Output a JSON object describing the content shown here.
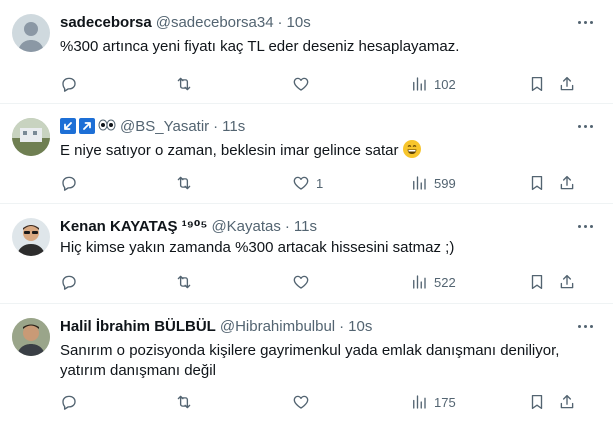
{
  "tweets": [
    {
      "name": "sadeceborsa",
      "handle": "@sadeceborsa34",
      "dot": "·",
      "time": "10s",
      "text": "%300 artınca yeni fiyatı kaç TL eder deseniz hesaplayamaz.",
      "replies": "",
      "retweets": "",
      "likes": "",
      "views": "102",
      "avatar_icon": "default-avatar-icon"
    },
    {
      "name": "",
      "handle": "@BS_Yasatir",
      "dot": "·",
      "time": "11s",
      "text": "E niye satıyor o zaman, beklesin imar gelince satar",
      "replies": "",
      "retweets": "",
      "likes": "1",
      "views": "599",
      "avatar_icon": "landscape-avatar-icon",
      "emoji_icon": "grinning-face-icon"
    },
    {
      "name": "Kenan KAYATAŞ ¹⁹⁰⁵",
      "handle": "@Kayatas",
      "dot": "·",
      "time": "11s",
      "text": "Hiç kimse yakın zamanda %300 artacak hissesini satmaz ;)",
      "replies": "",
      "retweets": "",
      "likes": "",
      "views": "522",
      "avatar_icon": "person-sunglasses-avatar-icon"
    },
    {
      "name": "Halil İbrahim BÜLBÜL",
      "handle": "@Hibrahimbulbul",
      "dot": "·",
      "time": "10s",
      "text": "Sanırım o pozisyonda kişilere gayrimenkul yada emlak danışmanı deniliyor, yatırım danışmanı değil",
      "replies": "",
      "retweets": "",
      "likes": "",
      "views": "175",
      "avatar_icon": "person-avatar-icon"
    }
  ],
  "colors": {
    "text": "#0f1419",
    "secondary": "#536471",
    "divider": "#eff3f4",
    "badge_blue": "#1d6fd6"
  }
}
